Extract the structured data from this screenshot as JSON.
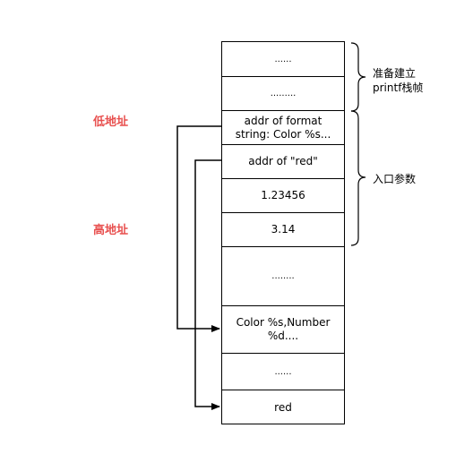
{
  "stack": {
    "cells": [
      {
        "text": "......",
        "small": true
      },
      {
        "text": ".........",
        "small": true
      },
      {
        "text": "addr of format\nstring: Color %s...",
        "small": false
      },
      {
        "text": "addr of \"red\"",
        "small": false
      },
      {
        "text": "1.23456",
        "small": false
      },
      {
        "text": "3.14",
        "small": false
      },
      {
        "text": "........",
        "small": true
      },
      {
        "text": "Color %s,Number\n%d....",
        "small": false
      },
      {
        "text": "......",
        "small": true
      },
      {
        "text": "red",
        "small": false
      }
    ]
  },
  "labels": {
    "low_address": "低地址",
    "high_address": "高地址"
  },
  "braces": {
    "printf_frame": "准备建立\nprintf栈帧",
    "entry_params": "入口参数"
  },
  "colors": {
    "address_label": "#e8504f",
    "line": "#000000"
  }
}
